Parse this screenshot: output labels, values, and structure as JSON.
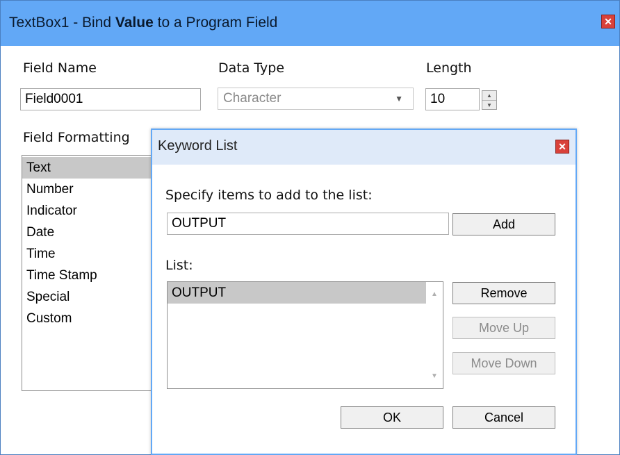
{
  "window": {
    "title_prefix": "TextBox1 - Bind ",
    "title_bold": "Value",
    "title_suffix": " to a Program Field",
    "close_glyph": "✕"
  },
  "form": {
    "field_name_label": "Field Name",
    "field_name_value": "Field0001",
    "data_type_label": "Data Type",
    "data_type_value": "Character",
    "length_label": "Length",
    "length_value": "10",
    "formatting_label": "Field Formatting",
    "formatting_items": [
      "Text",
      "Number",
      "Indicator",
      "Date",
      "Time",
      "Time Stamp",
      "Special",
      "Custom"
    ],
    "formatting_selected": "Text"
  },
  "dialog": {
    "title": "Keyword List",
    "close_glyph": "✕",
    "instruction": "Specify items to add to the list:",
    "input_value": "OUTPUT",
    "add_label": "Add",
    "list_label": "List:",
    "list_items": [
      "OUTPUT"
    ],
    "remove_label": "Remove",
    "move_up_label": "Move Up",
    "move_down_label": "Move Down",
    "ok_label": "OK",
    "cancel_label": "Cancel"
  },
  "colors": {
    "titlebar": "#62a8f6",
    "dialog_title": "#dfeaf9",
    "close_red": "#d9413a",
    "selection": "#c8c8c8"
  },
  "icons": [
    "close-icon",
    "spin-up-icon",
    "spin-down-icon",
    "dropdown-arrow-icon",
    "scroll-up-icon",
    "scroll-down-icon"
  ]
}
